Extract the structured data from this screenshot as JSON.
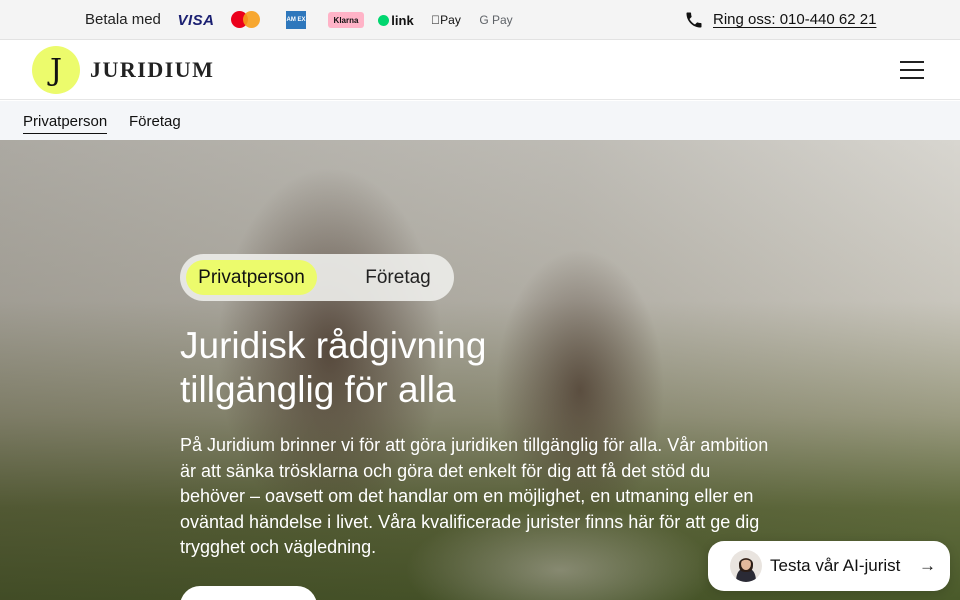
{
  "topbar": {
    "pay_label": "Betala med",
    "payment_logos": {
      "visa": "VISA",
      "amex": "AM EX",
      "klarna": "Klarna",
      "link": "link",
      "apple_pay": "Pay",
      "google_pay": "G Pay"
    },
    "phone_label": "Ring oss: 010-440 62 21"
  },
  "header": {
    "logo_letter": "J",
    "brand_name": "JURIDIUM",
    "menu_icon": "hamburger-menu-icon"
  },
  "subnav": {
    "items": [
      "Privatperson",
      "Företag"
    ],
    "active": "Privatperson"
  },
  "hero": {
    "toggle": {
      "options": [
        "Privatperson",
        "Företag"
      ],
      "selected": "Privatperson"
    },
    "title_line1": "Juridisk rådgivning",
    "title_line2": "tillgänglig för alla",
    "text": "På Juridium brinner vi för att göra juridiken tillgänglig för alla. Vår ambition är att sänka trösklarna och göra det enkelt för dig att få det stöd du behöver – oavsett om det handlar om en möjlighet, en utmaning eller en oväntad händelse i livet. Våra kvalificerade jurister finns här för att ge dig trygghet och vägledning."
  },
  "ai_chip": {
    "label": "Testa vår AI-jurist",
    "arrow": "→"
  },
  "colors": {
    "accent": "#ecfb6c",
    "topbar_bg": "#f4f4f4",
    "subnav_bg": "#f4f6f9"
  }
}
